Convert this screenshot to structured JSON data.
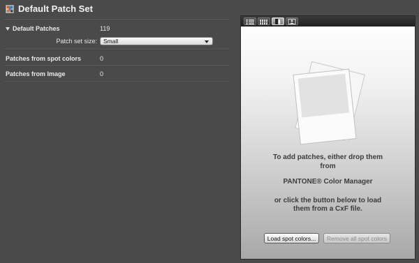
{
  "header": {
    "title": "Default Patch Set",
    "icon": "patch-set-icon"
  },
  "left": {
    "default_patches": {
      "label": "Default Patches",
      "value": "119"
    },
    "patch_set_size": {
      "label": "Patch set size:",
      "selected": "Small"
    },
    "spot_colors": {
      "label": "Patches from spot colors",
      "value": "0"
    },
    "from_image": {
      "label": "Patches from Image",
      "value": "0"
    }
  },
  "panel": {
    "toolbar": {
      "buttons": [
        "list-view-icon",
        "grid-view-icon",
        "swatch-view-icon",
        "image-view-icon"
      ],
      "active_index": 2
    },
    "message_line1": "To add patches, either drop them",
    "message_line2": "from",
    "message_line3": "PANTONE® Color Manager",
    "message_line4": "or click the button below to load",
    "message_line5": "them from a CxF file.",
    "load_button": "Load spot colors...",
    "remove_button": "Remove all spot colors"
  },
  "colors": {
    "background": "#4a4a4a",
    "panel_top": "#ffffff",
    "panel_bottom": "#a8a8a8",
    "toolbar": "#2a2a2a"
  }
}
